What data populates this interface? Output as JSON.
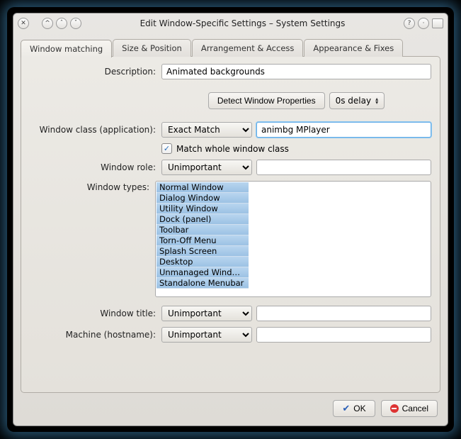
{
  "title": "Edit Window-Specific Settings – System Settings",
  "tabs": [
    "Window matching",
    "Size & Position",
    "Arrangement & Access",
    "Appearance & Fixes"
  ],
  "labels": {
    "description": "Description:",
    "windowClass": "Window class (application):",
    "windowRole": "Window role:",
    "windowTypes": "Window types:",
    "windowTitle": "Window title:",
    "machine": "Machine (hostname):"
  },
  "fields": {
    "description": "Animated backgrounds",
    "detectBtn": "Detect Window Properties",
    "delay": "0s delay",
    "classMatch": "Exact Match",
    "classValue": "animbg MPlayer",
    "matchWhole": "Match whole window class",
    "roleSelect": "Unimportant",
    "roleValue": "",
    "titleSelect": "Unimportant",
    "titleValue": "",
    "machineSelect": "Unimportant",
    "machineValue": ""
  },
  "windowTypes": [
    "Normal Window",
    "Dialog Window",
    "Utility Window",
    "Dock (panel)",
    "Toolbar",
    "Torn-Off Menu",
    "Splash Screen",
    "Desktop",
    "Unmanaged Wind…",
    "Standalone Menubar"
  ],
  "buttons": {
    "ok": "OK",
    "cancel": "Cancel"
  }
}
